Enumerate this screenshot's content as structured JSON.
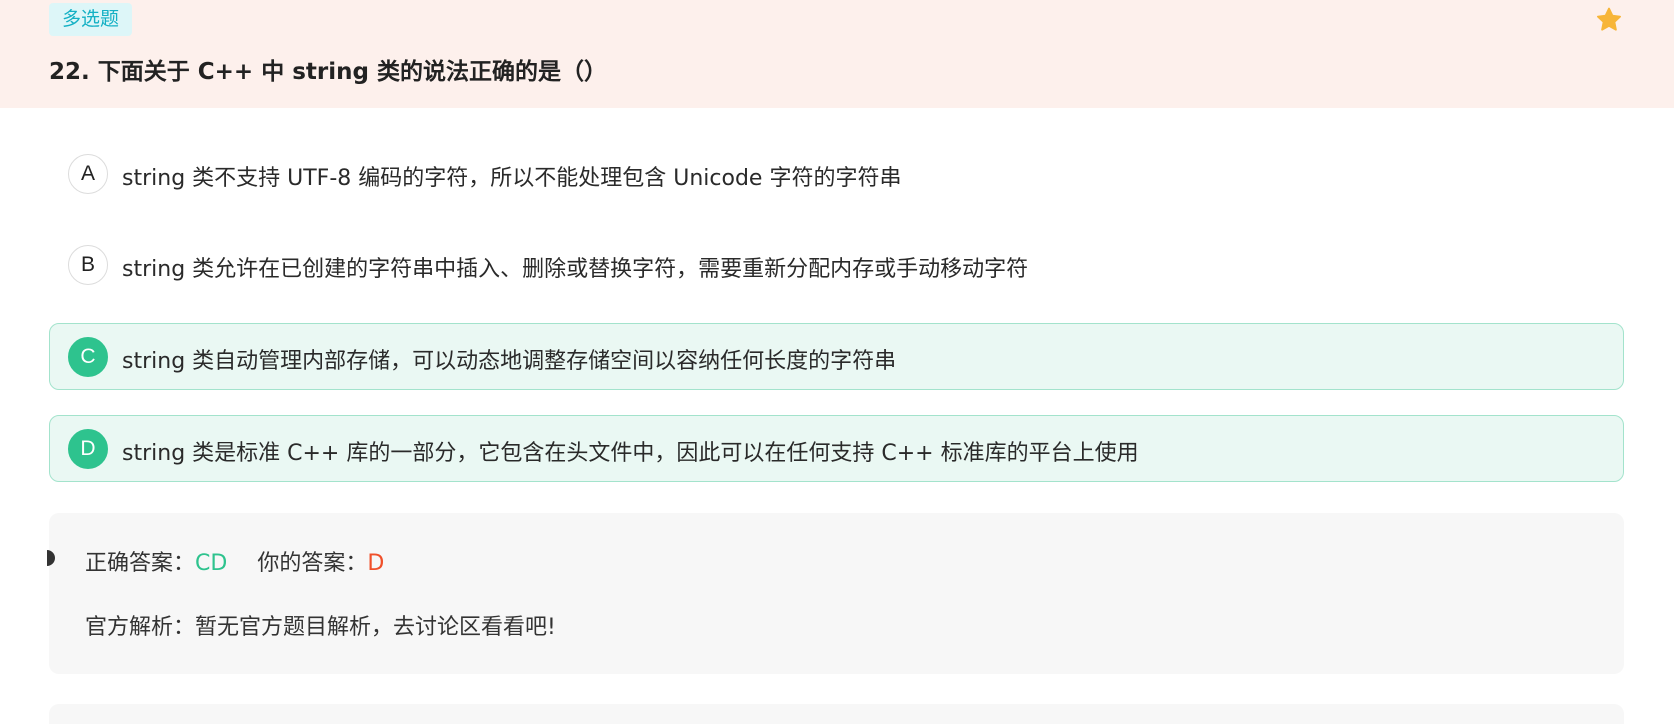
{
  "question": {
    "type_tag": "多选题",
    "title": "22. 下面关于 C++ 中 string 类的说法正确的是（）",
    "favorite_icon": "star-icon",
    "favorite_color": "#f7b538"
  },
  "options": [
    {
      "letter": "A",
      "text": "string 类不支持 UTF-8 编码的字符，所以不能处理包含 Unicode 字符的字符串",
      "selected": false
    },
    {
      "letter": "B",
      "text": "string 类允许在已创建的字符串中插入、删除或替换字符，需要重新分配内存或手动移动字符",
      "selected": false
    },
    {
      "letter": "C",
      "text": "string 类自动管理内部存储，可以动态地调整存储空间以容纳任何长度的字符串",
      "selected": true
    },
    {
      "letter": "D",
      "text": "string 类是标准 C++ 库的一部分，它包含在头文件中，因此可以在任何支持 C++ 标准库的平台上使用",
      "selected": true
    }
  ],
  "answer": {
    "correct_label": "正确答案：",
    "correct_value": "CD",
    "your_label": "你的答案：",
    "your_value": "D",
    "analysis": "官方解析：暂无官方题目解析，去讨论区看看吧!"
  },
  "colors": {
    "header_bg": "#fdf0ec",
    "accent_green": "#2ec38e",
    "wrong_red": "#f0502a",
    "tag_cyan": "#14b0c4"
  }
}
